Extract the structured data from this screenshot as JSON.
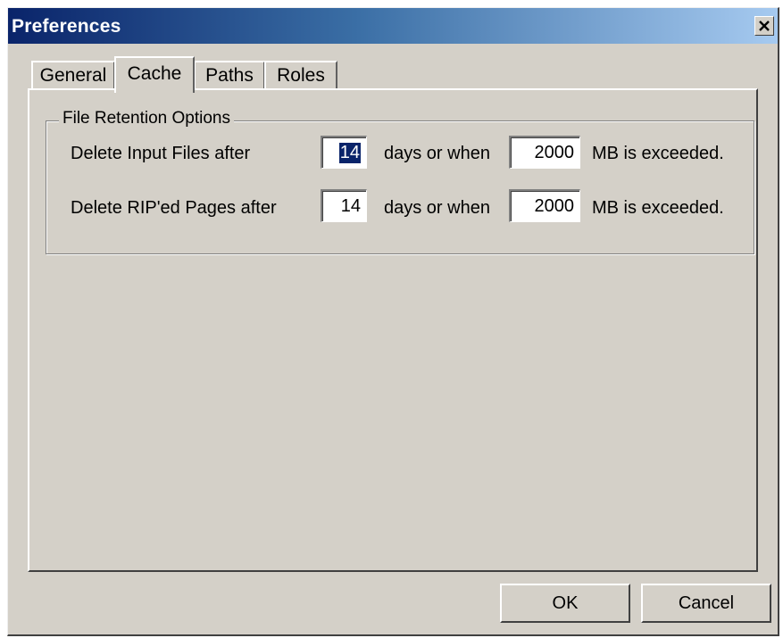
{
  "window": {
    "title": "Preferences"
  },
  "tabs": [
    {
      "label": "General",
      "active": false
    },
    {
      "label": "Cache",
      "active": true
    },
    {
      "label": "Paths",
      "active": false
    },
    {
      "label": "Roles",
      "active": false
    }
  ],
  "retention": {
    "group_title": "File Retention Options",
    "rows": [
      {
        "label": "Delete Input Files after",
        "days": "14",
        "days_suffix": "days or when",
        "mb": "2000",
        "mb_suffix": "MB is exceeded."
      },
      {
        "label": "Delete RIP'ed Pages after",
        "days": "14",
        "days_suffix": "days or when",
        "mb": "2000",
        "mb_suffix": "MB is exceeded."
      }
    ]
  },
  "buttons": {
    "ok": "OK",
    "cancel": "Cancel"
  },
  "icons": {
    "close": "close-icon"
  },
  "colors": {
    "titlebar_start": "#0a246a",
    "titlebar_end": "#a6caf0",
    "face": "#d4d0c8",
    "selection": "#0a246a"
  }
}
